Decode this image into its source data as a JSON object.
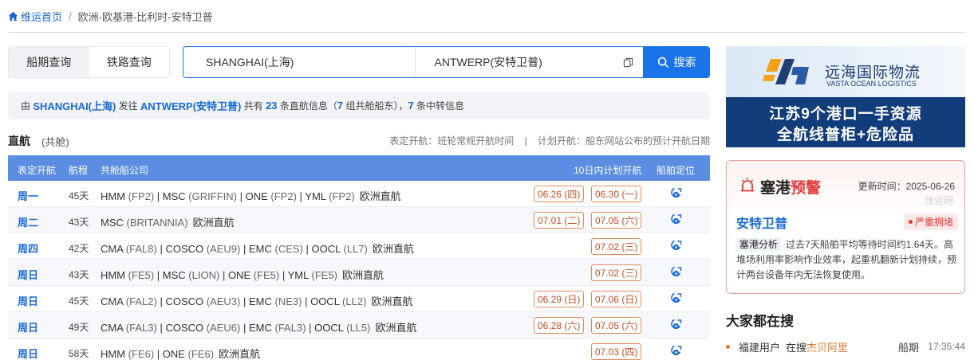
{
  "breadcrumb": {
    "home": "维运首页",
    "separator": "/",
    "current": "欧洲-欧基港-比利时-安特卫普"
  },
  "search": {
    "tabs": [
      "船期查询",
      "铁路查询"
    ],
    "origin": "SHANGHAI(上海)",
    "destination": "ANTWERP(安特卫普)",
    "button": "搜索"
  },
  "summary": {
    "p1": "由 ",
    "origin": "SHANGHAI(上海)",
    "p2": " 发往 ",
    "dest": "ANTWERP(安特卫普)",
    "p3": " 共有 ",
    "routes": "23",
    "p4": " 条直航信息（",
    "groups": "7",
    "p5": " 组共舱船东），",
    "transfers": "7",
    "p6": " 条中转信息"
  },
  "direct": {
    "title": "直航",
    "sub": "(共舱)",
    "legend": "表定开航：班轮常规开航时间    |    计划开航：船东网站公布的预计开航日期"
  },
  "table": {
    "headers": {
      "day": "表定开航",
      "days": "航程",
      "company": "共舱船公司",
      "plan": "10日内计划开航",
      "locate": "船舶定位"
    },
    "rows": [
      {
        "day": "周一",
        "days": "45天",
        "carriers": [
          [
            "HMM",
            "FP2"
          ],
          [
            "MSC",
            "GRIFFIN"
          ],
          [
            "ONE",
            "FP2"
          ],
          [
            "YML",
            "FP2"
          ]
        ],
        "dest": "欧洲直航",
        "dates": [
          "06.26 (四)",
          "06.30 (一)"
        ]
      },
      {
        "day": "周二",
        "days": "43天",
        "carriers": [
          [
            "MSC",
            "BRITANNIA"
          ]
        ],
        "dest": "欧洲直航",
        "dates": [
          "07.01 (二)",
          "07.05 (六)"
        ]
      },
      {
        "day": "周四",
        "days": "42天",
        "carriers": [
          [
            "CMA",
            "FAL8"
          ],
          [
            "COSCO",
            "AEU9"
          ],
          [
            "EMC",
            "CES"
          ],
          [
            "OOCL",
            "LL7"
          ]
        ],
        "dest": "欧洲直航",
        "dates": [
          "07.02 (三)"
        ]
      },
      {
        "day": "周日",
        "days": "43天",
        "carriers": [
          [
            "HMM",
            "FE5"
          ],
          [
            "MSC",
            "LION"
          ],
          [
            "ONE",
            "FE5"
          ],
          [
            "YML",
            "FE5"
          ]
        ],
        "dest": "欧洲直航",
        "dates": [
          "07.02 (三)"
        ]
      },
      {
        "day": "周日",
        "days": "45天",
        "carriers": [
          [
            "CMA",
            "FAL2"
          ],
          [
            "COSCO",
            "AEU3"
          ],
          [
            "EMC",
            "NE3"
          ],
          [
            "OOCL",
            "LL2"
          ]
        ],
        "dest": "欧洲直航",
        "dates": [
          "06.29 (日)",
          "07.06 (日)"
        ]
      },
      {
        "day": "周日",
        "days": "49天",
        "carriers": [
          [
            "CMA",
            "FAL3"
          ],
          [
            "COSCO",
            "AEU6"
          ],
          [
            "EMC",
            "FAL3"
          ],
          [
            "OOCL",
            "LL5"
          ]
        ],
        "dest": "欧洲直航",
        "dates": [
          "06.28 (六)",
          "07.05 (六)"
        ]
      },
      {
        "day": "周日",
        "days": "58天",
        "carriers": [
          [
            "HMM",
            "FE6"
          ],
          [
            "ONE",
            "FE6"
          ]
        ],
        "dest": "欧洲直航",
        "dates": [
          "07.03 (四)"
        ]
      }
    ]
  },
  "ad": {
    "company_cn": "远海国际物流",
    "company_en": "VASTA OCEAN LOGISTICS",
    "line1": "江苏9个港口一手资源",
    "line2": "全航线普柜+危险品"
  },
  "alert": {
    "title_a": "塞港",
    "title_b": "预警",
    "updated": "更新时间：2025-06-26",
    "watermark": "维运网",
    "port": "安特卫普",
    "badge": "严重拥堵",
    "key": "塞港分析",
    "text": "过去7天船舶平均等待时间约1.64天。高堆场利用率影响作业效率，起重机翻新计划持续，预计两台设备年内无法恢复使用。"
  },
  "hot": {
    "title": "大家都在搜",
    "items": [
      {
        "user": "福建用户",
        "in": "在搜",
        "keyword": "杰贝阿里",
        "type": "船期",
        "time": "17:35:44"
      }
    ]
  },
  "colors": {
    "accent": "#1a73e8",
    "link": "#1a6ad8",
    "header": "#5b8ee2",
    "tag": "#c64b22",
    "alert": "#e53a3a"
  }
}
